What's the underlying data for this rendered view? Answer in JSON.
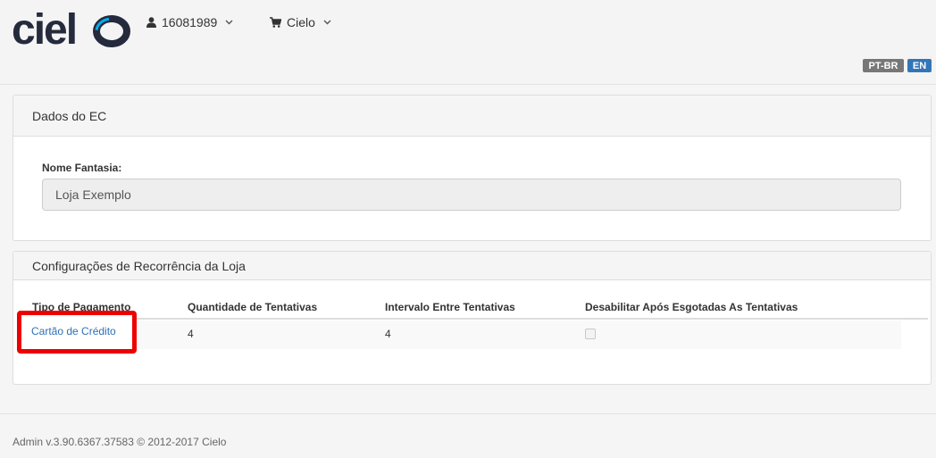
{
  "brand": {
    "name": "cielo",
    "color": "#252a3c",
    "accent": "#00aeef"
  },
  "nav": {
    "user_label": "16081989",
    "store_label": "Cielo"
  },
  "languages": [
    "PT-BR",
    "EN"
  ],
  "ec_panel": {
    "title": "Dados do EC",
    "field_label": "Nome Fantasia:",
    "field_value": "Loja Exemplo"
  },
  "recurrence_panel": {
    "title": "Configurações de Recorrência da Loja",
    "columns": [
      "Tipo de Pagamento",
      "Quantidade de Tentativas",
      "Intervalo Entre Tentativas",
      "Desabilitar Após Esgotadas As Tentativas"
    ],
    "rows": [
      {
        "payment_type": "Cartão de Crédito",
        "attempts": "4",
        "interval": "4",
        "disable_after": false
      }
    ]
  },
  "footer": {
    "text": "Admin v.3.90.6367.37583 © 2012-2017 Cielo"
  },
  "colors": {
    "link": "#2f6fb5",
    "highlight": "#ee0000",
    "lang_active": "#3376b7",
    "lang_inactive": "#777777"
  }
}
